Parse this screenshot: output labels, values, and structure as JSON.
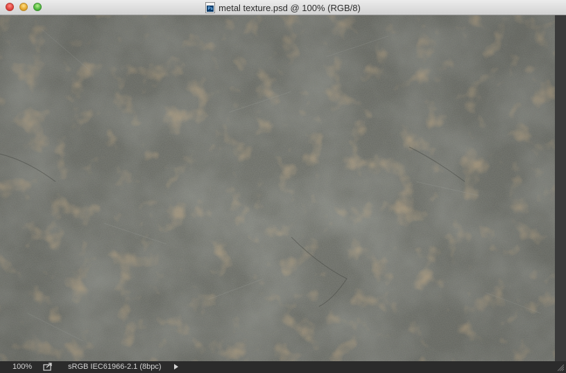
{
  "window": {
    "title": "metal texture.psd @ 100% (RGB/8)",
    "file_icon": "ps-icon",
    "file_icon_label": "Ps"
  },
  "canvas": {
    "description_colors": {
      "base": "#6b6d66",
      "rust": "#9b6a3a",
      "dark": "#474a45",
      "light": "#9a9d96"
    }
  },
  "status": {
    "zoom": "100%",
    "doc_info": "sRGB IEC61966-2.1 (8bpc)"
  }
}
